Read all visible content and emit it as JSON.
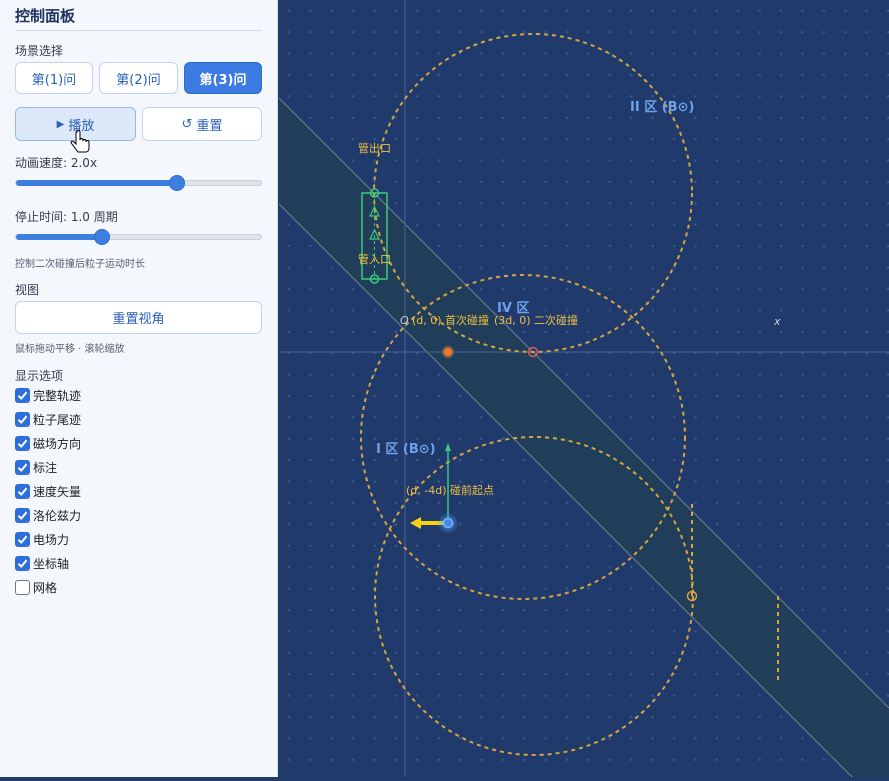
{
  "panel": {
    "title": "控制面板",
    "scene_label": "场景选择",
    "scenes": [
      "第(1)问",
      "第(2)问",
      "第(3)问"
    ],
    "active_scene": 2,
    "play_label": "播放",
    "reset_label": "重置",
    "speed_label": "动画速度: 2.0x",
    "speed_fraction": 0.65,
    "stop_label": "停止时间: 1.0 周期",
    "stop_fraction": 0.35,
    "stop_hint": "控制二次碰撞后粒子运动时长",
    "view_label": "视图",
    "reset_view_label": "重置视角",
    "view_hint": "鼠标拖动平移 · 滚轮缩放",
    "display_label": "显示选项",
    "options": [
      {
        "label": "完整轨迹",
        "checked": true
      },
      {
        "label": "粒子尾迹",
        "checked": true
      },
      {
        "label": "磁场方向",
        "checked": true
      },
      {
        "label": "标注",
        "checked": true
      },
      {
        "label": "速度矢量",
        "checked": true
      },
      {
        "label": "洛伦兹力",
        "checked": true
      },
      {
        "label": "电场力",
        "checked": true
      },
      {
        "label": "坐标轴",
        "checked": true
      },
      {
        "label": "网格",
        "checked": false
      }
    ]
  },
  "scene": {
    "region_2": "II 区 (B⊙)",
    "region_4": "IV 区",
    "region_1": "I 区 (B⊙)",
    "pipe_out": "管出口",
    "pipe_in": "管入口",
    "origin": "O",
    "first_collision": "(d, 0) 首次碰撞",
    "second_collision": "(3d, 0) 二次碰撞",
    "start_point": "(d, -4d) 碰前起点",
    "x_axis": "x"
  },
  "colors": {
    "background": "#1f3a6b",
    "accent": "#3b7be2",
    "trajectory": "#d6a542",
    "annotation": "#f0c040",
    "region_label": "#6fa1ea",
    "pipe": "#3ec97a",
    "particle": "#3d8df0",
    "lorentz": "#f5d20f"
  }
}
